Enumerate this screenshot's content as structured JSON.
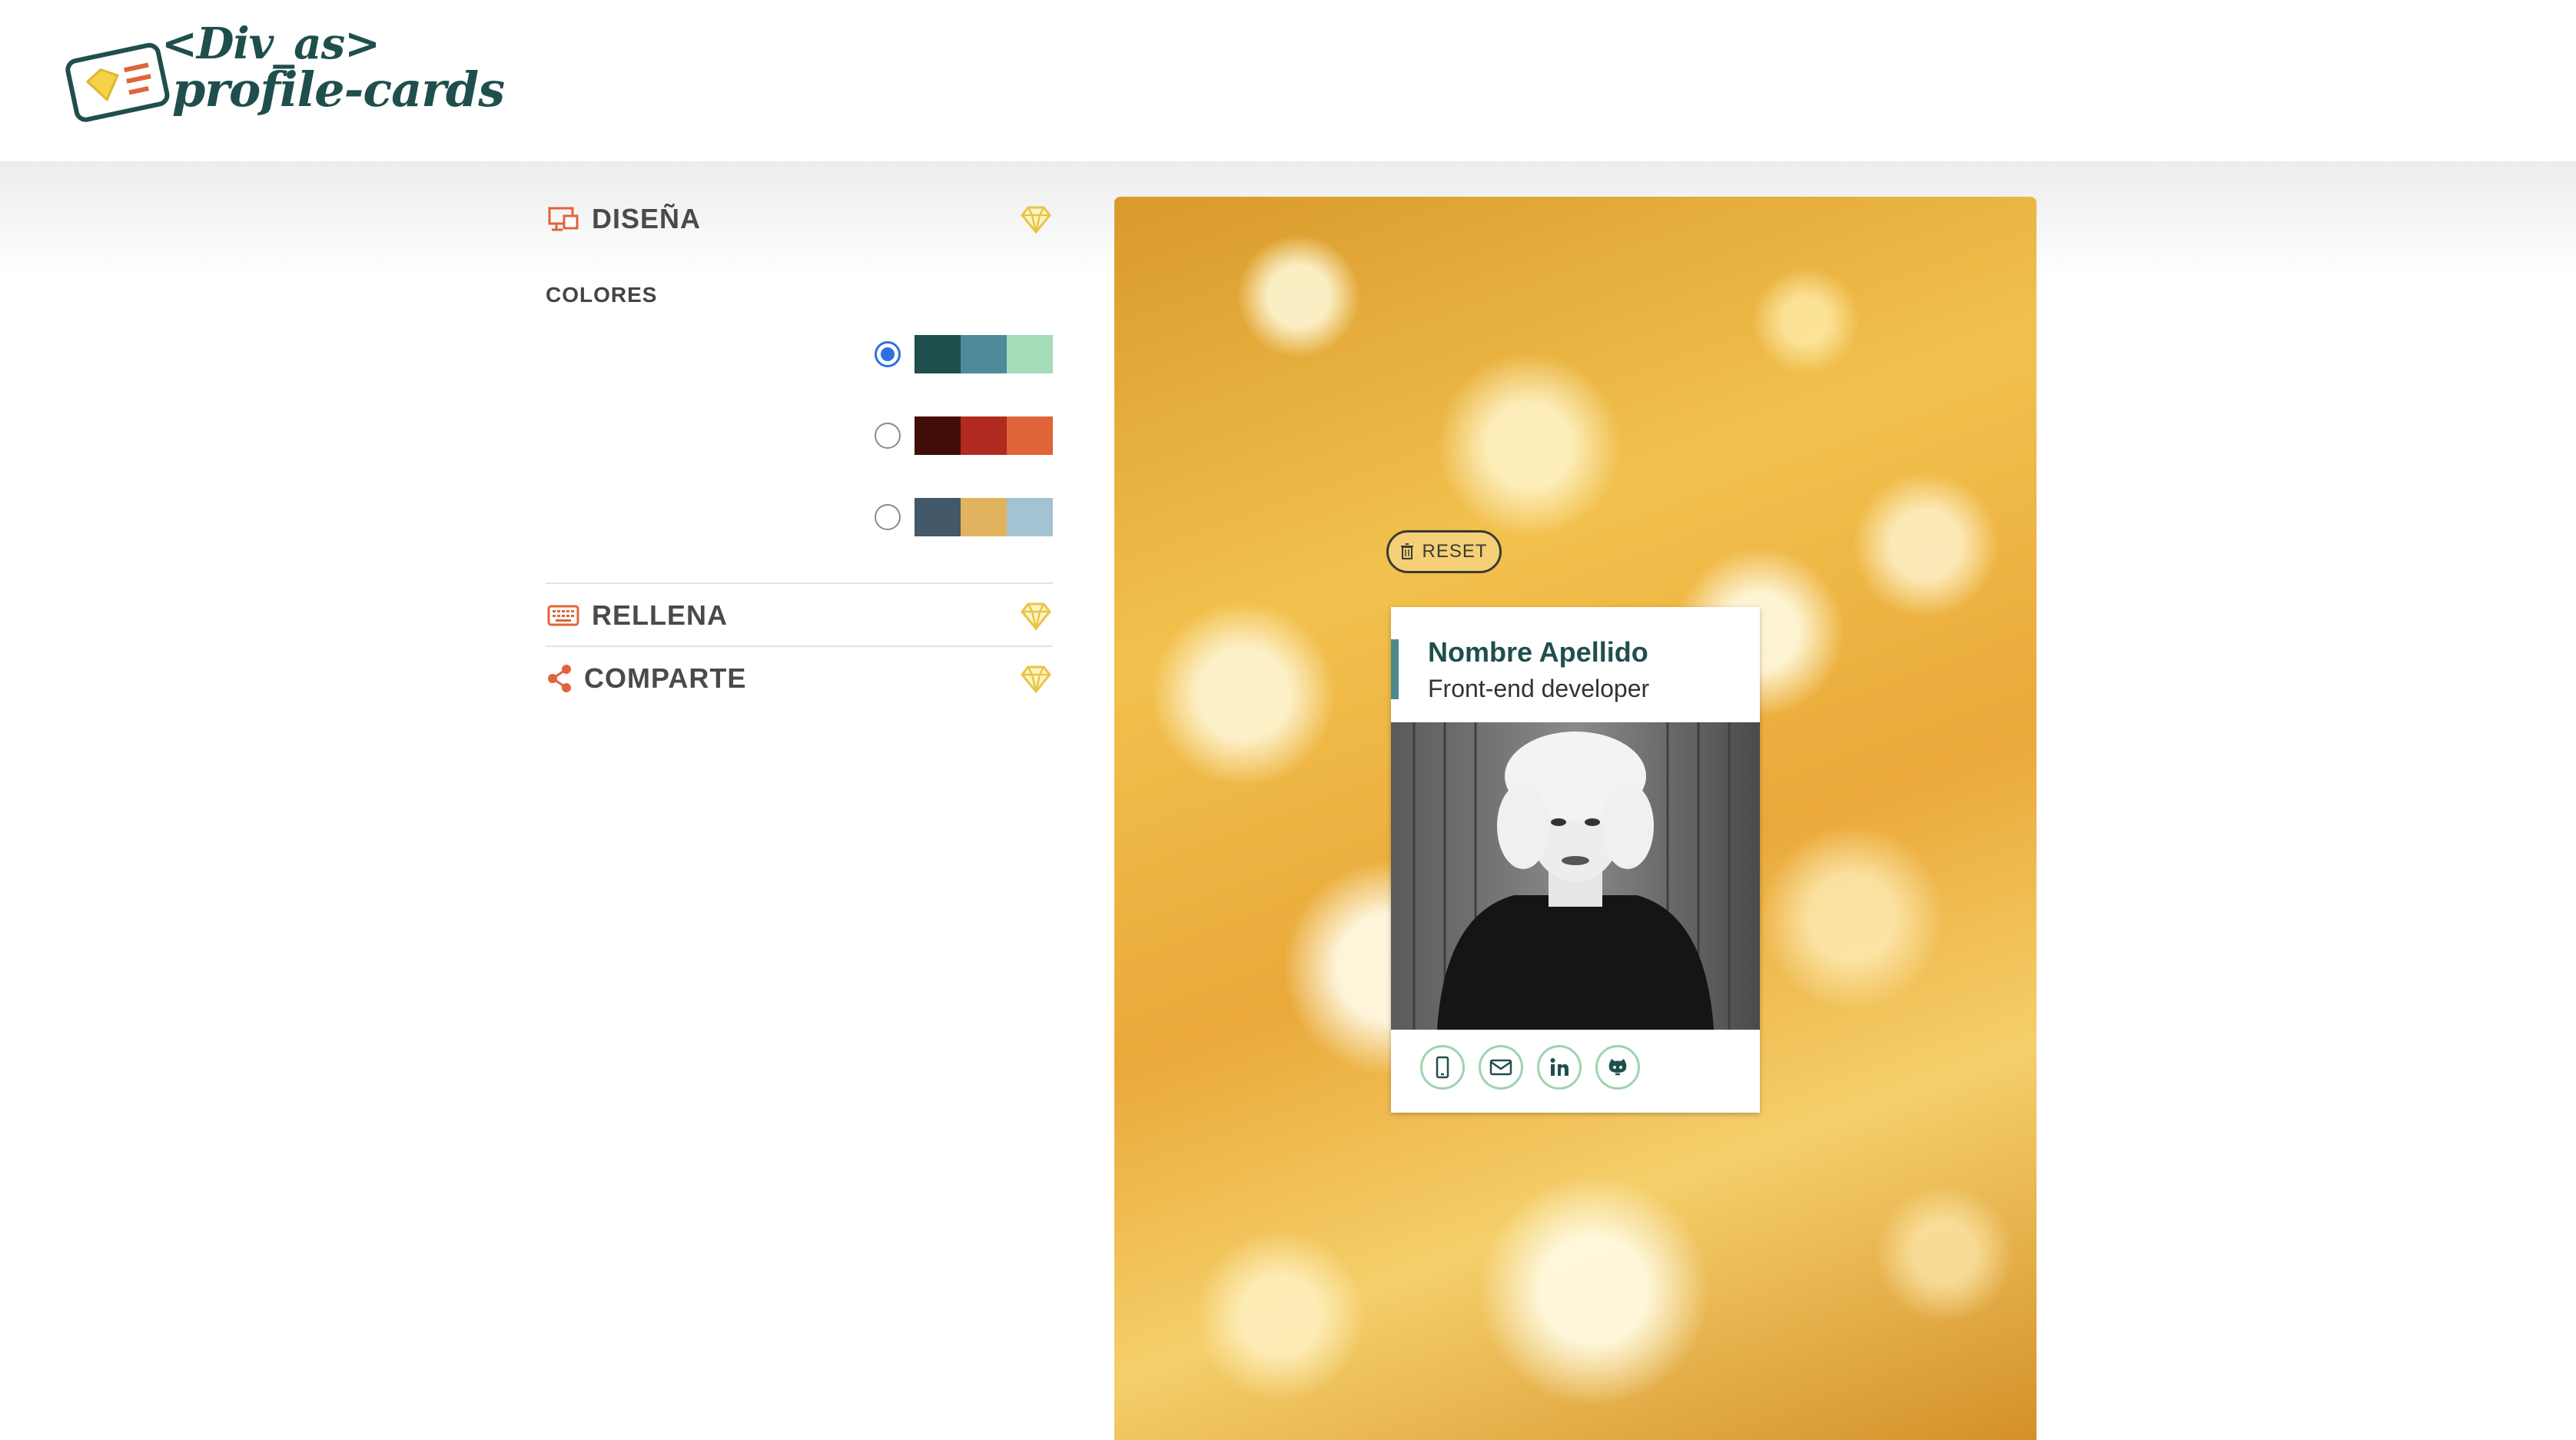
{
  "header": {
    "logo_line1": "<Div_as>",
    "logo_line2": "profile-cards"
  },
  "panel": {
    "design": {
      "title": "DISEÑA",
      "icon": "design-icon"
    },
    "colors_label": "COLORES",
    "palettes": [
      {
        "selected": true,
        "colors": [
          "#1f4f4c",
          "#4e8a9a",
          "#a6dcb8"
        ]
      },
      {
        "selected": false,
        "colors": [
          "#420c09",
          "#b12a20",
          "#e0643a"
        ]
      },
      {
        "selected": false,
        "colors": [
          "#435868",
          "#e2b35e",
          "#a3c2d2"
        ]
      }
    ],
    "fill": {
      "title": "RELLENA",
      "icon": "keyboard-icon"
    },
    "share": {
      "title": "COMPARTE",
      "icon": "share-icon"
    }
  },
  "preview": {
    "reset_label": "RESET",
    "card": {
      "name": "Nombre Apellido",
      "job": "Front-end developer",
      "icons": [
        "phone-icon",
        "email-icon",
        "linkedin-icon",
        "github-icon"
      ]
    }
  },
  "colors": {
    "accent_orange": "#e0643a",
    "gem_yellow": "#e8c547",
    "primary_dark": "#1f4f4c",
    "icon_border": "#9fd3b0"
  }
}
